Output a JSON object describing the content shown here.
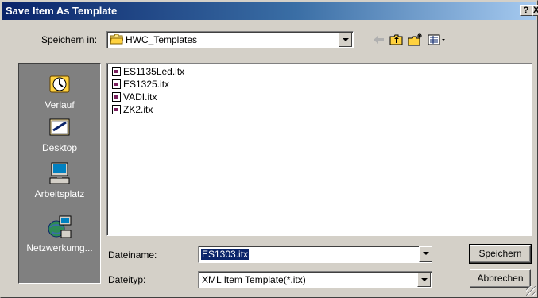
{
  "window": {
    "title": "Save Item As Template",
    "help_label": "?",
    "close_label": "X"
  },
  "location": {
    "label": "Speichern in:",
    "value": "HWC_Templates",
    "icon": "folder-icon"
  },
  "toolbar": {
    "back_icon": "back-arrow-icon",
    "up_icon": "up-folder-icon",
    "new_folder_icon": "new-folder-icon",
    "view_icon": "view-menu-icon"
  },
  "places": [
    {
      "label": "Verlauf",
      "icon": "history-icon"
    },
    {
      "label": "Desktop",
      "icon": "desktop-icon"
    },
    {
      "label": "Arbeitsplatz",
      "icon": "computer-icon"
    },
    {
      "label": "Netzwerkumg...",
      "icon": "network-icon"
    }
  ],
  "files": [
    "ES1135Led.itx",
    "ES1325.itx",
    "VADI.itx",
    "ZK2.itx"
  ],
  "filename": {
    "label": "Dateiname:",
    "value": "ES1303.itx"
  },
  "filetype": {
    "label": "Dateityp:",
    "value": "XML Item Template(*.itx)"
  },
  "buttons": {
    "save": "Speichern",
    "cancel": "Abbrechen"
  },
  "colors": {
    "titlebar_start": "#0a246a",
    "titlebar_end": "#a6caf0",
    "selection": "#0a246a",
    "face": "#d4d0c8"
  }
}
